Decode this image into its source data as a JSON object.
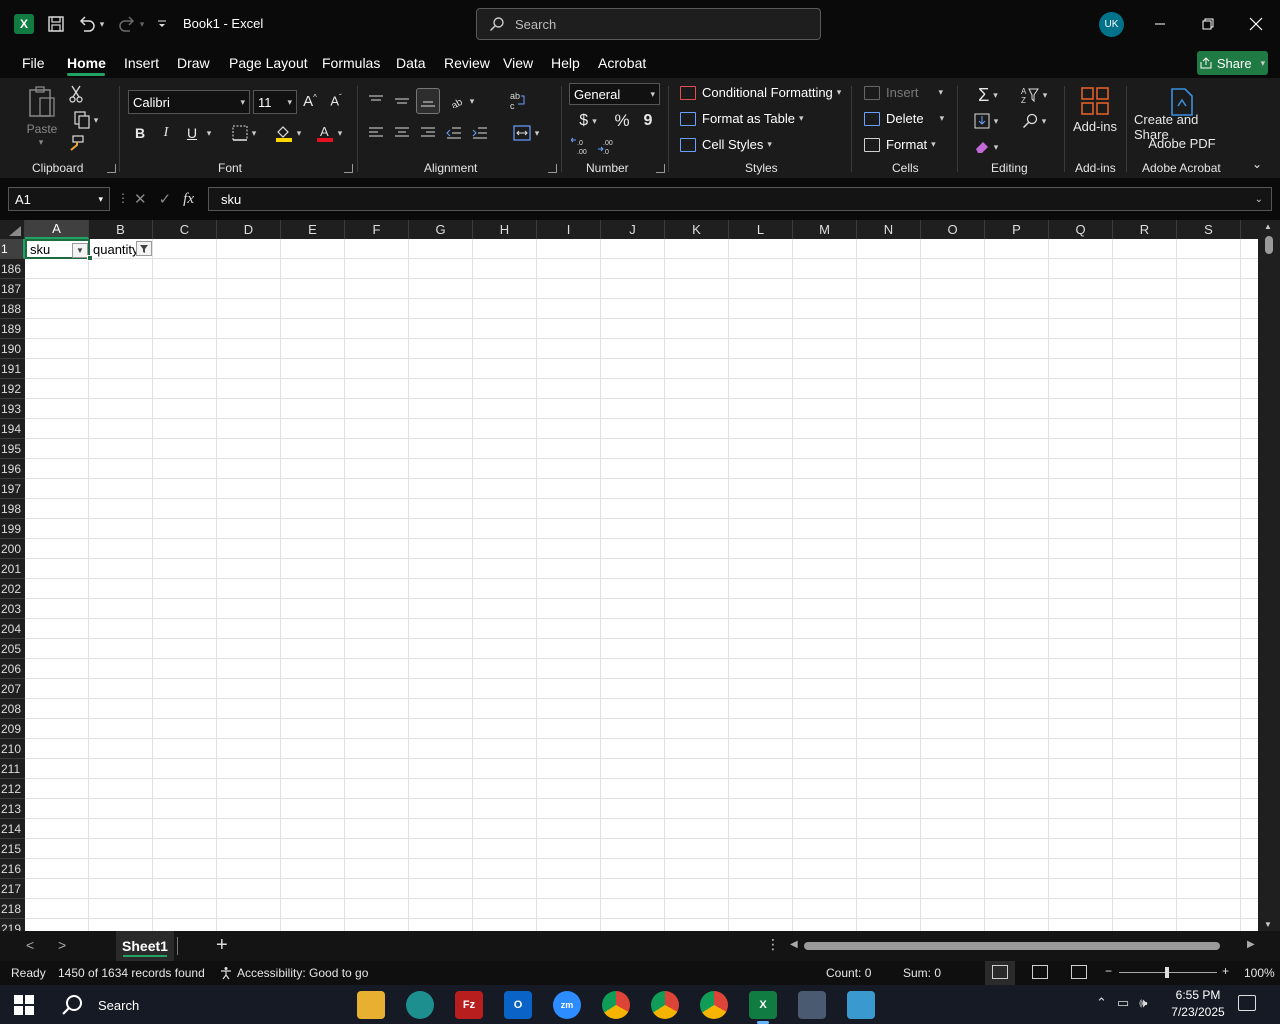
{
  "window": {
    "app_icon": "X",
    "title": "Book1  -  Excel",
    "search_placeholder": "Search",
    "avatar_initials": "UK"
  },
  "tabs": [
    "File",
    "Home",
    "Insert",
    "Draw",
    "Page Layout",
    "Formulas",
    "Data",
    "Review",
    "View",
    "Help",
    "Acrobat"
  ],
  "active_tab": "Home",
  "share_label": "Share",
  "ribbon": {
    "clipboard": {
      "paste": "Paste",
      "label": "Clipboard"
    },
    "font": {
      "family": "Calibri",
      "size": "11",
      "bold": "B",
      "italic": "I",
      "underline": "U",
      "label": "Font"
    },
    "alignment": {
      "label": "Alignment"
    },
    "number": {
      "format": "General",
      "currency": "$",
      "percent": "%",
      "comma": "9",
      "label": "Number"
    },
    "styles": {
      "conditional": "Conditional Formatting",
      "table": "Format as Table",
      "cell_styles": "Cell Styles",
      "label": "Styles"
    },
    "cells": {
      "insert": "Insert",
      "delete": "Delete",
      "format": "Format",
      "label": "Cells"
    },
    "editing": {
      "label": "Editing"
    },
    "addins": {
      "button": "Add-ins",
      "label": "Add-ins"
    },
    "acrobat": {
      "button_line1": "Create and Share",
      "button_line2": "Adobe PDF",
      "label": "Adobe Acrobat"
    }
  },
  "formula_bar": {
    "name_box": "A1",
    "fx": "fx",
    "content": "sku"
  },
  "grid": {
    "columns": [
      "A",
      "B",
      "C",
      "D",
      "E",
      "F",
      "G",
      "H",
      "I",
      "J",
      "K",
      "L",
      "M",
      "N",
      "O",
      "P",
      "Q",
      "R",
      "S"
    ],
    "selected_column": "A",
    "rows": [
      "1",
      "186",
      "187",
      "188",
      "189",
      "190",
      "191",
      "192",
      "193",
      "194",
      "195",
      "196",
      "197",
      "198",
      "199",
      "200",
      "201",
      "202",
      "203",
      "204",
      "205",
      "206",
      "207",
      "208",
      "209",
      "210",
      "211",
      "212",
      "213",
      "214",
      "215",
      "216",
      "217",
      "218",
      "219"
    ],
    "selected_row": "1",
    "cell_a1": "sku",
    "cell_b1": "quantity"
  },
  "sheets": {
    "active": "Sheet1"
  },
  "status": {
    "ready": "Ready",
    "records": "1450 of 1634 records found",
    "accessibility": "Accessibility: Good to go",
    "count": "Count: 0",
    "sum": "Sum: 0",
    "zoom": "100%"
  },
  "taskbar": {
    "search": "Search",
    "time": "6:55 PM",
    "date": "7/23/2025"
  }
}
